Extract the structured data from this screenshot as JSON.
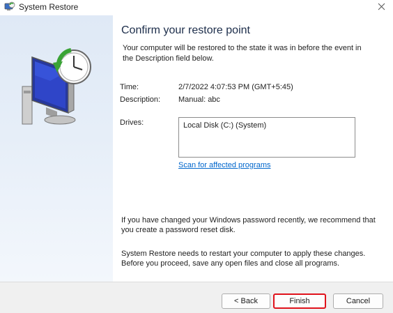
{
  "window": {
    "title": "System Restore",
    "icon": "system-restore-icon",
    "close_icon": "close-icon"
  },
  "main": {
    "heading": "Confirm your restore point",
    "intro": "Your computer will be restored to the state it was in before the event in the Description field below.",
    "time_label": "Time:",
    "time_value": "2/7/2022 4:07:53 PM (GMT+5:45)",
    "description_label": "Description:",
    "description_value": "Manual: abc",
    "drives_label": "Drives:",
    "drives": [
      "Local Disk (C:) (System)"
    ],
    "scan_link": "Scan for affected programs",
    "password_note": "If you have changed your Windows password recently, we recommend that you create a password reset disk.",
    "restart_note": "System Restore needs to restart your computer to apply these changes. Before you proceed, save any open files and close all programs."
  },
  "buttons": {
    "back": "< Back",
    "finish": "Finish",
    "cancel": "Cancel"
  },
  "colors": {
    "link": "#0066cc",
    "highlight": "#e0121b",
    "sidebar": "#dfe9f6"
  }
}
